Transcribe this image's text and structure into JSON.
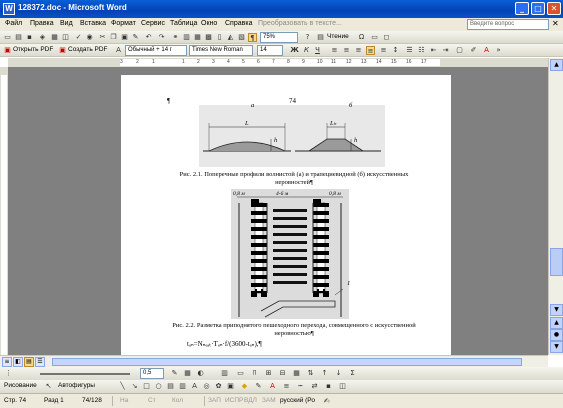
{
  "window": {
    "title": "128372.doc - Microsoft Word",
    "icon_label": "W",
    "buttons": {
      "minimize": "_",
      "maximize": "□",
      "close": "✕"
    }
  },
  "menu": {
    "items": [
      "Файл",
      "Правка",
      "Вид",
      "Вставка",
      "Формат",
      "Сервис",
      "Таблица",
      "Окно",
      "Справка"
    ],
    "disabled_item": "Преобразовать в тексте...",
    "help_placeholder": "Введите вопрос",
    "doc_close": "✕"
  },
  "toolbar_standard": {
    "zoom": "75%",
    "read_label": "Чтение"
  },
  "toolbar_pdf": {
    "open_pdf": "Открыть PDF",
    "create_pdf": "Создать PDF"
  },
  "toolbar_format": {
    "style": "Обычный + 14 г",
    "font": "Times New Roman",
    "size": "14",
    "bold": "Ж",
    "italic": "К",
    "underline": "Ч"
  },
  "ruler": {
    "numbers": [
      "3",
      "2",
      "1",
      "1",
      "2",
      "3",
      "4",
      "5",
      "6",
      "7",
      "8",
      "9",
      "10",
      "11",
      "12",
      "13",
      "14",
      "15",
      "16",
      "17"
    ]
  },
  "document": {
    "paragraph_mark": "¶",
    "page_number": "74",
    "fig1_label_a": "а",
    "fig1_label_b": "б",
    "fig1_dim_l": "L",
    "fig1_dim_lh": "Lₕ",
    "fig1_h": "h",
    "fig1_caption": "Рис. 2.1. Поперечные профили волнистой (а) и трапециевидной (б) искусственных неровностей¶",
    "fig2_dim_left": "0,8 м",
    "fig2_dim_mid": "4-6 м",
    "fig2_dim_right": "0,8 м",
    "fig2_label_1": "1",
    "fig2_caption": "Рис. 2.2. Разметка приподнятого пешеходного перехода, совмещенного с искусственной неровностью¶",
    "formula": "tₐₙ=Nₙₑₐₜ·Tₐₙ·f/(3600-tₐₙ),¶"
  },
  "drawing_toolbar": {
    "line_width": "0,5",
    "draw_label": "Рисование",
    "autoshapes_label": "Автофигуры"
  },
  "status": {
    "page": "Стр. 74",
    "section": "Разд 1",
    "pages": "74/128",
    "at": "На",
    "line": "Ст",
    "col": "Кол",
    "rec": "ЗАП",
    "trk": "ИСПР",
    "ext": "ВДЛ",
    "ovr": "ЗАМ",
    "language": "русский (Ро"
  }
}
